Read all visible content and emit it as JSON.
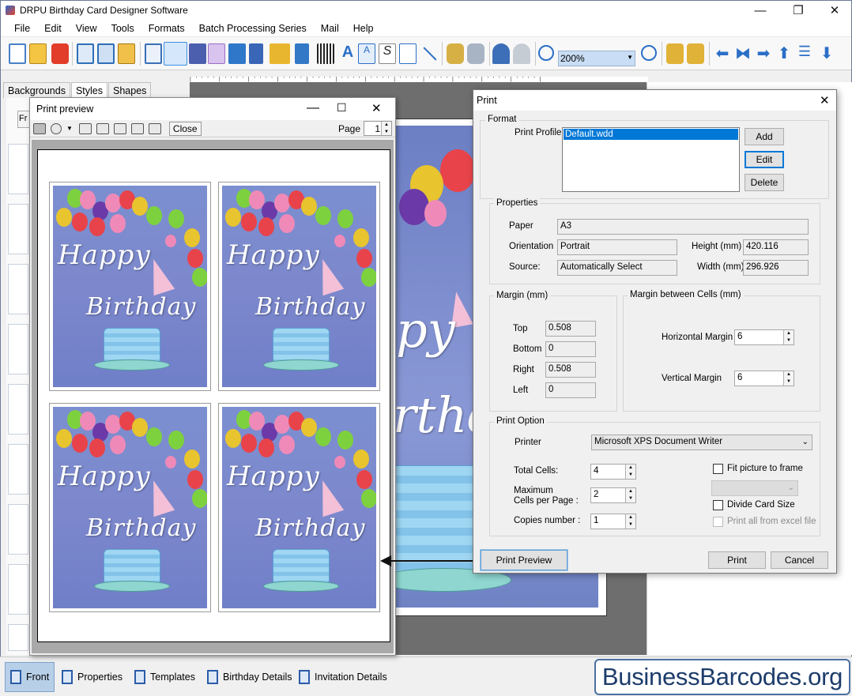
{
  "app": {
    "title": "DRPU Birthday Card Designer Software"
  },
  "menu": [
    "File",
    "Edit",
    "View",
    "Tools",
    "Formats",
    "Batch Processing Series",
    "Mail",
    "Help"
  ],
  "toolbar": {
    "zoom": "200%"
  },
  "left_tabs": [
    "Backgrounds",
    "Styles",
    "Shapes"
  ],
  "left_panel_button": "Fr",
  "bottom_tabs": [
    "Front",
    "Properties",
    "Templates",
    "Birthday Details",
    "Invitation Details"
  ],
  "brand": "BusinessBarcodes.org",
  "card": {
    "line1": "Happy",
    "line2": "Birthday",
    "bg_partial_1": "py",
    "bg_partial_2": "rthd"
  },
  "print_preview": {
    "title": "Print preview",
    "close_label": "Close",
    "page_label": "Page",
    "page_value": "1"
  },
  "print_dialog": {
    "title": "Print",
    "format_group": "Format",
    "print_profile_label": "Print Profile",
    "profile_selected": "Default.wdd",
    "add_label": "Add",
    "edit_label": "Edit",
    "delete_label": "Delete",
    "properties_group": "Properties",
    "paper_label": "Paper",
    "paper_value": "A3",
    "orientation_label": "Orientation",
    "orientation_value": "Portrait",
    "source_label": "Source:",
    "source_value": "Automatically Select",
    "height_label": "Height (mm)",
    "height_value": "420.116",
    "width_label": "Width (mm)",
    "width_value": "296.926",
    "margin_group": "Margin (mm)",
    "top_label": "Top",
    "top_value": "0.508",
    "bottom_label": "Bottom",
    "bottom_value": "0",
    "right_label": "Right",
    "right_value": "0.508",
    "left_label": "Left",
    "left_value": "0",
    "cells_group": "Margin between Cells (mm)",
    "hmargin_label": "Horizontal Margin",
    "hmargin_value": "6",
    "vmargin_label": "Vertical Margin",
    "vmargin_value": "6",
    "print_option_group": "Print Option",
    "printer_label": "Printer",
    "printer_value": "Microsoft XPS Document Writer",
    "total_cells_label": "Total Cells:",
    "total_cells_value": "4",
    "max_cells_label_1": "Maximum",
    "max_cells_label_2": "Cells per Page :",
    "max_cells_value": "2",
    "copies_label": "Copies number :",
    "copies_value": "1",
    "fit_picture_label": "Fit picture to frame",
    "divide_card_label": "Divide Card Size",
    "print_all_label": "Print all from excel file",
    "print_preview_button": "Print Preview",
    "print_button": "Print",
    "cancel_button": "Cancel"
  },
  "colors": {
    "accent": "#0078d7",
    "card_bg": "#7b8fd0",
    "brand_text": "#1d3c6b"
  }
}
